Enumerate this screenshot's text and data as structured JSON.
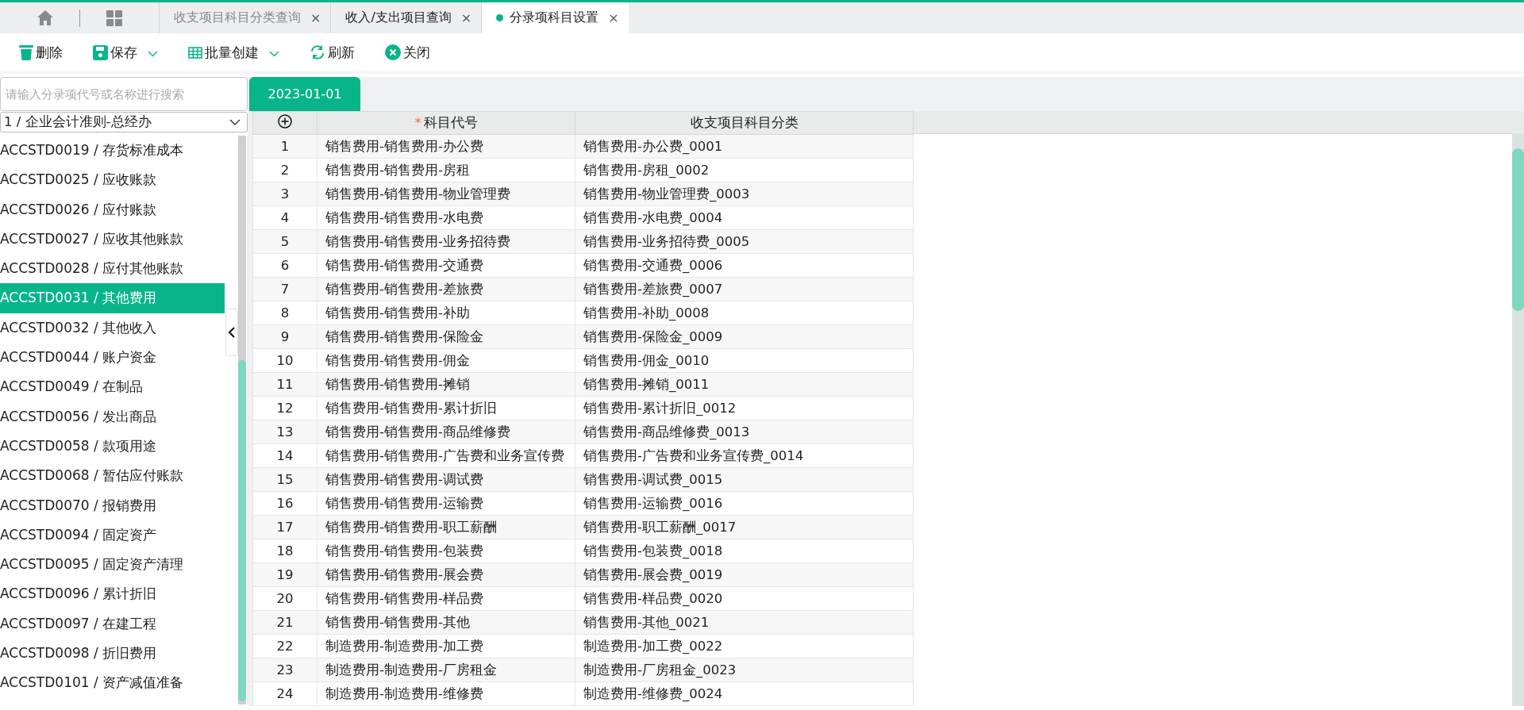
{
  "tabs": [
    {
      "label": "收支项目科目分类查询",
      "selected": false,
      "dot": false,
      "close": "×"
    },
    {
      "label": "收入/支出项目查询",
      "selected": false,
      "dot": false,
      "close": "×"
    },
    {
      "label": "分录项科目设置",
      "selected": true,
      "dot": true,
      "close": "×"
    }
  ],
  "toolbar": [
    {
      "kind": "trash",
      "label": "删除",
      "dropdown": false
    },
    {
      "kind": "save",
      "label": "保存",
      "dropdown": true
    },
    {
      "kind": "grid",
      "label": "批量创建",
      "dropdown": true
    },
    {
      "kind": "refresh",
      "label": "刷新",
      "dropdown": false
    },
    {
      "kind": "close",
      "label": "关闭",
      "dropdown": false
    }
  ],
  "sidebar": {
    "search": {
      "placeholder": "请输入分录项代号或名称进行搜索"
    },
    "select": {
      "value": "1 / 企业会计准则-总经办"
    },
    "items": [
      {
        "label": "ACCSTD0019 / 存货标准成本",
        "selected": false
      },
      {
        "label": "ACCSTD0025 / 应收账款",
        "selected": false
      },
      {
        "label": "ACCSTD0026 / 应付账款",
        "selected": false
      },
      {
        "label": "ACCSTD0027 / 应收其他账款",
        "selected": false
      },
      {
        "label": "ACCSTD0028 / 应付其他账款",
        "selected": false
      },
      {
        "label": "ACCSTD0031 / 其他费用",
        "selected": true
      },
      {
        "label": "ACCSTD0032 / 其他收入",
        "selected": false
      },
      {
        "label": "ACCSTD0044 / 账户资金",
        "selected": false
      },
      {
        "label": "ACCSTD0049 / 在制品",
        "selected": false
      },
      {
        "label": "ACCSTD0056 / 发出商品",
        "selected": false
      },
      {
        "label": "ACCSTD0058 / 款项用途",
        "selected": false
      },
      {
        "label": "ACCSTD0068 / 暂估应付账款",
        "selected": false
      },
      {
        "label": "ACCSTD0070 / 报销费用",
        "selected": false
      },
      {
        "label": "ACCSTD0094 / 固定资产",
        "selected": false
      },
      {
        "label": "ACCSTD0095 / 固定资产清理",
        "selected": false
      },
      {
        "label": "ACCSTD0096 / 累计折旧",
        "selected": false
      },
      {
        "label": "ACCSTD0097 / 在建工程",
        "selected": false
      },
      {
        "label": "ACCSTD0098 / 折旧费用",
        "selected": false
      },
      {
        "label": "ACCSTD0101 / 资产减值准备",
        "selected": false
      }
    ]
  },
  "date_tabs": [
    {
      "label": "2023-01-01",
      "selected": true
    }
  ],
  "table": {
    "columns": [
      {
        "kind": "add"
      },
      {
        "kind": "text",
        "label": "科目代号",
        "marker": "*"
      },
      {
        "kind": "text",
        "label": "收支项目科目分类"
      }
    ],
    "rows": [
      [
        "1",
        "销售费用-销售费用-办公费",
        "销售费用-办公费_0001"
      ],
      [
        "2",
        "销售费用-销售费用-房租",
        "销售费用-房租_0002"
      ],
      [
        "3",
        "销售费用-销售费用-物业管理费",
        "销售费用-物业管理费_0003"
      ],
      [
        "4",
        "销售费用-销售费用-水电费",
        "销售费用-水电费_0004"
      ],
      [
        "5",
        "销售费用-销售费用-业务招待费",
        "销售费用-业务招待费_0005"
      ],
      [
        "6",
        "销售费用-销售费用-交通费",
        "销售费用-交通费_0006"
      ],
      [
        "7",
        "销售费用-销售费用-差旅费",
        "销售费用-差旅费_0007"
      ],
      [
        "8",
        "销售费用-销售费用-补助",
        "销售费用-补助_0008"
      ],
      [
        "9",
        "销售费用-销售费用-保险金",
        "销售费用-保险金_0009"
      ],
      [
        "10",
        "销售费用-销售费用-佣金",
        "销售费用-佣金_0010"
      ],
      [
        "11",
        "销售费用-销售费用-摊销",
        "销售费用-摊销_0011"
      ],
      [
        "12",
        "销售费用-销售费用-累计折旧",
        "销售费用-累计折旧_0012"
      ],
      [
        "13",
        "销售费用-销售费用-商品维修费",
        "销售费用-商品维修费_0013"
      ],
      [
        "14",
        "销售费用-销售费用-广告费和业务宣传费",
        "销售费用-广告费和业务宣传费_0014"
      ],
      [
        "15",
        "销售费用-销售费用-调试费",
        "销售费用-调试费_0015"
      ],
      [
        "16",
        "销售费用-销售费用-运输费",
        "销售费用-运输费_0016"
      ],
      [
        "17",
        "销售费用-销售费用-职工薪酬",
        "销售费用-职工薪酬_0017"
      ],
      [
        "18",
        "销售费用-销售费用-包装费",
        "销售费用-包装费_0018"
      ],
      [
        "19",
        "销售费用-销售费用-展会费",
        "销售费用-展会费_0019"
      ],
      [
        "20",
        "销售费用-销售费用-样品费",
        "销售费用-样品费_0020"
      ],
      [
        "21",
        "销售费用-销售费用-其他",
        "销售费用-其他_0021"
      ],
      [
        "22",
        "制造费用-制造费用-加工费",
        "制造费用-加工费_0022"
      ],
      [
        "23",
        "制造费用-制造费用-厂房租金",
        "制造费用-厂房租金_0023"
      ],
      [
        "24",
        "制造费用-制造费用-维修费",
        "制造费用-维修费_0024"
      ]
    ]
  }
}
